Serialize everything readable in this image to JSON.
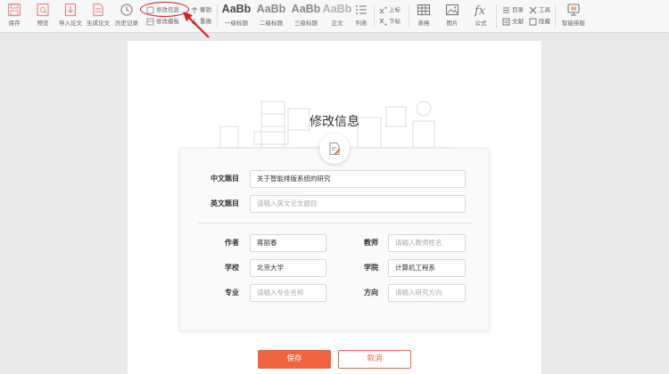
{
  "toolbar": {
    "save": "保存",
    "preview": "预览",
    "import_paper": "导入论文",
    "generate_paper": "生成论文",
    "history": "历史记录",
    "edit_info": "修改信息",
    "edit_template": "修改模板",
    "undo": "撤销",
    "redo": "重做",
    "style_sample": "AaBb",
    "heading1": "一级标题",
    "heading2": "二级标题",
    "heading3": "三级标题",
    "body_text": "正文",
    "list": "列表",
    "superscript": "上标",
    "subscript": "下标",
    "table": "表格",
    "image": "图片",
    "formula": "公式",
    "toc": "目录",
    "tools": "工具",
    "reference": "文献",
    "hide": "隐藏",
    "smart_layout": "智能排版"
  },
  "modal": {
    "title": "修改信息",
    "cn_title_label": "中文题目",
    "cn_title_value": "关于智能排版系统的研究",
    "en_title_label": "英文题目",
    "en_title_placeholder": "请输入英文论文题目",
    "author_label": "作者",
    "author_value": "蒋丽春",
    "teacher_label": "教师",
    "teacher_placeholder": "请输入教师姓名",
    "school_label": "学校",
    "school_value": "北京大学",
    "college_label": "学院",
    "college_value": "计算机工程系",
    "major_label": "专业",
    "major_placeholder": "请输入专业名称",
    "direction_label": "方向",
    "direction_placeholder": "请输入研究方向",
    "save_button": "保存",
    "cancel_button": "取消"
  },
  "colors": {
    "accent": "#f0653f",
    "highlight": "#e0191f",
    "toolbar_bg": "#f7f7f7",
    "workspace_bg": "#e9e9e9"
  }
}
